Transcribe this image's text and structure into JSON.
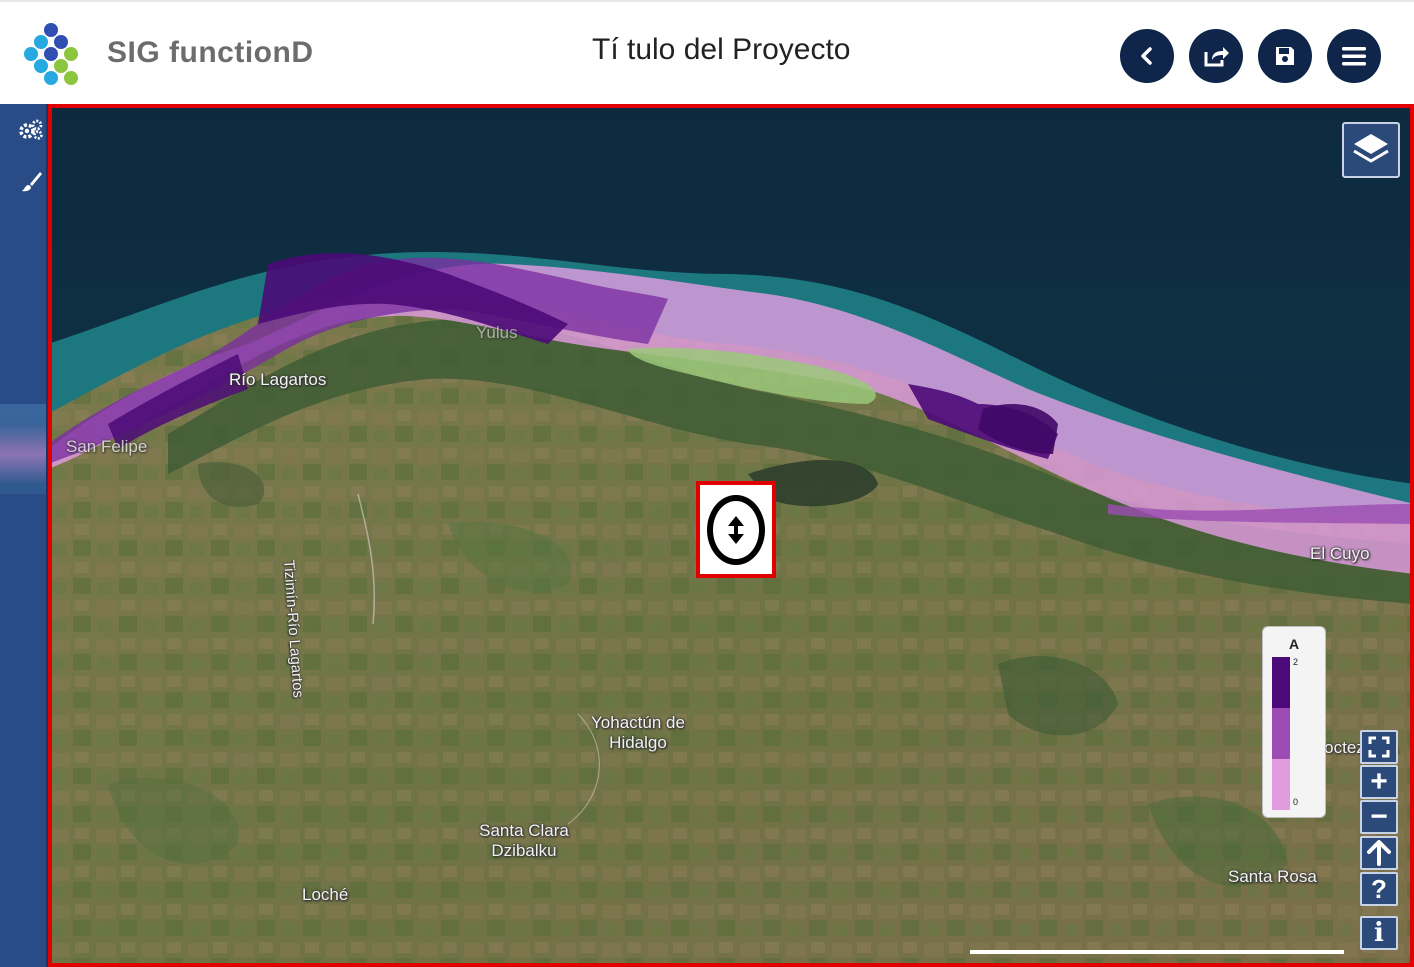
{
  "header": {
    "brand": "SIG functionD",
    "title": "Tí tulo del Proyecto",
    "buttons": [
      {
        "name": "back-button",
        "icon": "chevron-left-icon"
      },
      {
        "name": "share-button",
        "icon": "share-icon"
      },
      {
        "name": "save-button",
        "icon": "floppy-disk-icon"
      },
      {
        "name": "menu-button",
        "icon": "hamburger-menu-icon"
      }
    ],
    "accent_color": "#10254a"
  },
  "sidebar": {
    "tools": [
      {
        "name": "settings-tool",
        "icon": "gears-icon"
      },
      {
        "name": "style-tool",
        "icon": "paintbrush-icon"
      }
    ],
    "color": "#2a4c86"
  },
  "map": {
    "places": [
      {
        "name": "Río Lagartos"
      },
      {
        "name": "San Felipe"
      },
      {
        "name": "Yulus"
      },
      {
        "name": "Tizimín-Río Lagartos"
      },
      {
        "name": "El Cuyo"
      },
      {
        "name": "Yohactún de Hidalgo"
      },
      {
        "name": "Santa Clara Dzibalku"
      },
      {
        "name": "Loché"
      },
      {
        "name": "Santa Rosa"
      },
      {
        "name": "Moctezuma"
      }
    ],
    "layer_button_icon": "layers-icon",
    "center_control_icon": "vertical-arrows-icon",
    "legend": {
      "title": "A",
      "max_label": "2",
      "min_label": "0",
      "colors": [
        "#4b0a78",
        "#9c4cb2",
        "#e19ce0"
      ]
    },
    "controls": [
      {
        "name": "fullscreen-button",
        "icon": "fullscreen-icon"
      },
      {
        "name": "zoom-in-button",
        "symbol": "+"
      },
      {
        "name": "zoom-out-button",
        "symbol": "−"
      },
      {
        "name": "north-button",
        "icon": "arrow-up-icon"
      },
      {
        "name": "help-button",
        "symbol": "?"
      },
      {
        "name": "info-button",
        "symbol": "i"
      }
    ],
    "zone_colors": {
      "high": "#4b0a78",
      "medium": "#9c4cb2",
      "low": "#e19ce0"
    }
  }
}
